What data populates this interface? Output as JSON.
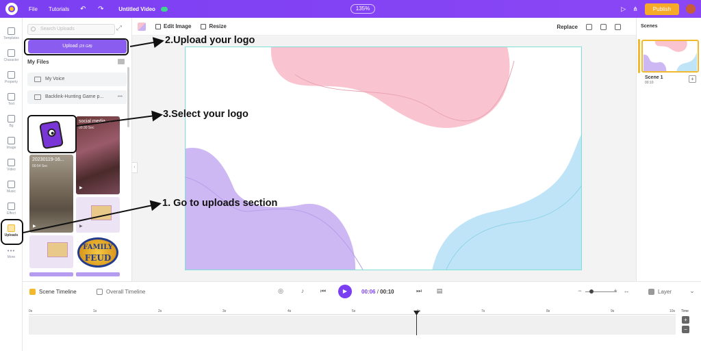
{
  "topbar": {
    "menu_file": "File",
    "menu_tutorials": "Tutorials",
    "video_title": "Untitled Video",
    "zoom": "135%",
    "publish": "Publish"
  },
  "rail": {
    "items": [
      {
        "label": "Templates"
      },
      {
        "label": "Character"
      },
      {
        "label": "Property"
      },
      {
        "label": "Text"
      },
      {
        "label": "Bg"
      },
      {
        "label": "Image"
      },
      {
        "label": "Video"
      },
      {
        "label": "Music"
      },
      {
        "label": "Effect"
      },
      {
        "label": "Uploads"
      },
      {
        "label": "More"
      }
    ]
  },
  "panel": {
    "search_placeholder": "Search Uploads",
    "upload_label": "Upload",
    "upload_quota": "(25 GB)",
    "my_files": "My Files",
    "folders": [
      "My Voice",
      "Backlink-Hunting Game p..."
    ],
    "thumbs": [
      {
        "title": "social media ...",
        "duration": "00:30 Sec"
      },
      {
        "title": "20230119-16...",
        "duration": "00:54 Sec"
      }
    ],
    "feud_line1": "FAMILY",
    "feud_line2": "FEUD"
  },
  "toolbar": {
    "edit_image": "Edit Image",
    "resize": "Resize",
    "replace": "Replace"
  },
  "scenes": {
    "title": "Scenes",
    "scene_name": "Scene 1",
    "scene_duration": "00:10"
  },
  "timeline": {
    "scene_timeline": "Scene Timeline",
    "overall_timeline": "Overall Timeline",
    "current_time": "00:06",
    "separator": " / ",
    "total_time": "00:10",
    "layer": "Layer",
    "ticks": [
      "0s",
      "1s",
      "2s",
      "3s",
      "4s",
      "5s",
      "6s",
      "7s",
      "8s",
      "9s",
      "10s"
    ],
    "time_label": "Time"
  },
  "annotations": {
    "step1": "1. Go to uploads section",
    "step2": "2.Upload your logo",
    "step3": "3.Select your logo"
  },
  "colors": {
    "brand": "#7b3ff2",
    "publish": "#f7a928",
    "active": "#f2b92c"
  }
}
